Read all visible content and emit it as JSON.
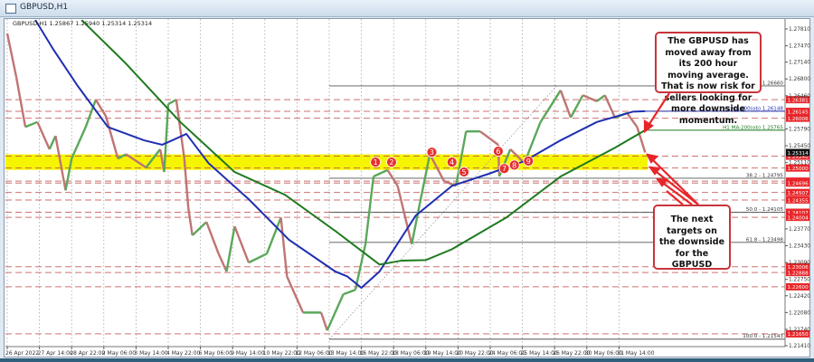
{
  "window": {
    "title": "GBPUSD,H1"
  },
  "info_line": "GBPUSD,H1  1.25867 1.25940 1.25314 1.25314",
  "callouts": {
    "top": "The GBPUSD has moved away from its 200 hour moving average. That is now risk for sellers looking for more downside momentum.",
    "bottom": "The next targets on the downside for the GBPUSD"
  },
  "colors": {
    "ma100": "#1f2fb0",
    "ma200": "#1e7a1e",
    "up": "#5aa85a",
    "down": "#c07474",
    "level": "#c0504d",
    "zone": "#f5f500",
    "label": "#e8262a"
  },
  "chart_data": {
    "type": "line",
    "title": "GBPUSD,H1",
    "x_unit": "hourly bar index",
    "ylim": [
      1.2141,
      1.2781
    ],
    "grid": true,
    "x_ticks": [
      {
        "bar": 0,
        "label": "26 Apr 2022"
      },
      {
        "bar": 16,
        "label": "27 Apr 14:00"
      },
      {
        "bar": 32,
        "label": "28 Apr 22:00"
      },
      {
        "bar": 48,
        "label": "2 May 06:00"
      },
      {
        "bar": 64,
        "label": "3 May 14:00"
      },
      {
        "bar": 80,
        "label": "4 May 22:00"
      },
      {
        "bar": 96,
        "label": "6 May 06:00"
      },
      {
        "bar": 112,
        "label": "9 May 14:00"
      },
      {
        "bar": 128,
        "label": "10 May 22:00"
      },
      {
        "bar": 144,
        "label": "12 May 06:00"
      },
      {
        "bar": 160,
        "label": "13 May 14:00"
      },
      {
        "bar": 176,
        "label": "16 May 22:00"
      },
      {
        "bar": 192,
        "label": "18 May 06:00"
      },
      {
        "bar": 208,
        "label": "19 May 14:00"
      },
      {
        "bar": 224,
        "label": "20 May 22:00"
      },
      {
        "bar": 240,
        "label": "24 May 06:00"
      },
      {
        "bar": 256,
        "label": "25 May 14:00"
      },
      {
        "bar": 272,
        "label": "26 May 22:00"
      },
      {
        "bar": 288,
        "label": "30 May 06:00"
      },
      {
        "bar": 304,
        "label": "31 May 14:00"
      }
    ],
    "y_ticks": [
      "1.27810",
      "1.27470",
      "1.27140",
      "1.26800",
      "1.26460",
      "1.25790",
      "1.25450",
      "1.25110",
      "1.23770",
      "1.23430",
      "1.23090",
      "1.22750",
      "1.22420",
      "1.22080",
      "1.21740",
      "1.21410"
    ],
    "price": [
      [
        0,
        1.2772
      ],
      [
        4.5,
        1.2684
      ],
      [
        9,
        1.2583
      ],
      [
        15,
        1.2593
      ],
      [
        21,
        1.2538
      ],
      [
        24,
        1.2565
      ],
      [
        29,
        1.2455
      ],
      [
        32,
        1.2519
      ],
      [
        39,
        1.2583
      ],
      [
        44,
        1.2638
      ],
      [
        49,
        1.2605
      ],
      [
        55,
        1.2519
      ],
      [
        59,
        1.2528
      ],
      [
        69,
        1.2501
      ],
      [
        76,
        1.2538
      ],
      [
        78,
        1.2492
      ],
      [
        80,
        1.2629
      ],
      [
        84,
        1.2638
      ],
      [
        88,
        1.2519
      ],
      [
        90,
        1.2419
      ],
      [
        92,
        1.2364
      ],
      [
        99,
        1.2391
      ],
      [
        105,
        1.2327
      ],
      [
        109,
        1.2291
      ],
      [
        113,
        1.2382
      ],
      [
        120,
        1.2309
      ],
      [
        129,
        1.2327
      ],
      [
        136,
        1.24
      ],
      [
        139,
        1.2281
      ],
      [
        147,
        1.2208
      ],
      [
        156,
        1.2208
      ],
      [
        159,
        1.2172
      ],
      [
        167,
        1.2245
      ],
      [
        173,
        1.2254
      ],
      [
        178,
        1.2346
      ],
      [
        182,
        1.2483
      ],
      [
        189,
        1.2496
      ],
      [
        194,
        1.2464
      ],
      [
        201,
        1.2346
      ],
      [
        205,
        1.2428
      ],
      [
        210,
        1.2528
      ],
      [
        217,
        1.2474
      ],
      [
        223,
        1.2464
      ],
      [
        228,
        1.2574
      ],
      [
        235,
        1.2574
      ],
      [
        244,
        1.2547
      ],
      [
        244.5,
        1.2483
      ],
      [
        250,
        1.2538
      ],
      [
        257,
        1.251
      ],
      [
        265,
        1.2593
      ],
      [
        275,
        1.2657
      ],
      [
        280,
        1.2602
      ],
      [
        286,
        1.2647
      ],
      [
        293,
        1.2635
      ],
      [
        297,
        1.2647
      ],
      [
        302,
        1.2602
      ],
      [
        308,
        1.2611
      ],
      [
        313,
        1.2583
      ],
      [
        317,
        1.25314
      ]
    ],
    "series": [
      {
        "name": "H1 MA:100",
        "label": "H1 MA:100(ob) 1.26148",
        "value": 1.26148,
        "points": [
          [
            14,
            1.2799
          ],
          [
            23,
            1.2739
          ],
          [
            35,
            1.2666
          ],
          [
            50,
            1.2583
          ],
          [
            68,
            1.2556
          ],
          [
            77,
            1.2547
          ],
          [
            82,
            1.2556
          ],
          [
            89,
            1.2569
          ],
          [
            100,
            1.251
          ],
          [
            120,
            1.2437
          ],
          [
            140,
            1.2355
          ],
          [
            163,
            1.2291
          ],
          [
            169,
            1.2281
          ],
          [
            176,
            1.2258
          ],
          [
            185,
            1.2291
          ],
          [
            203,
            1.2404
          ],
          [
            221,
            1.2464
          ],
          [
            239,
            1.2488
          ],
          [
            257,
            1.2514
          ],
          [
            275,
            1.2556
          ],
          [
            293,
            1.2593
          ],
          [
            311,
            1.2614
          ],
          [
            317,
            1.26148
          ]
        ]
      },
      {
        "name": "H1 MA:200",
        "label": "H1 MA:200(ob) 1.25765",
        "value": 1.25765,
        "points": [
          [
            37,
            1.2799
          ],
          [
            59,
            1.2711
          ],
          [
            86,
            1.2593
          ],
          [
            113,
            1.2492
          ],
          [
            138,
            1.2446
          ],
          [
            163,
            1.2373
          ],
          [
            185,
            1.2305
          ],
          [
            196,
            1.2313
          ],
          [
            208,
            1.2314
          ],
          [
            221,
            1.2336
          ],
          [
            248,
            1.24
          ],
          [
            275,
            1.2483
          ],
          [
            302,
            1.2541
          ],
          [
            317,
            1.25765
          ]
        ]
      }
    ],
    "fib": {
      "start_bar": 160,
      "end_bar": 273,
      "levels": [
        {
          "label": "0.0 - 1.26660",
          "value": 1.2666
        },
        {
          "label": "38.2 - 1.24795",
          "value": 1.24795
        },
        {
          "label": "50.0 - 1.24105",
          "value": 1.24105
        },
        {
          "label": "61.8 - 1.23498",
          "value": 1.23498
        },
        {
          "label": "100.0 - 1.21543",
          "value": 1.21543
        }
      ]
    },
    "support_zone": [
      1.25,
      1.2524
    ],
    "levels": [
      "1.26381",
      "1.26145",
      "1.26006",
      "1.25240",
      "1.25000",
      "1.24736",
      "1.24696",
      "1.24507",
      "1.24355",
      "1.24107",
      "1.24004",
      "1.23006",
      "1.22888",
      "1.22600",
      "1.21650"
    ],
    "current_price": "1.25314",
    "markers": [
      {
        "n": "1",
        "bar": 183,
        "price": 1.2512
      },
      {
        "n": "2",
        "bar": 191,
        "price": 1.2512
      },
      {
        "n": "3",
        "bar": 211,
        "price": 1.2532
      },
      {
        "n": "4",
        "bar": 221,
        "price": 1.2512
      },
      {
        "n": "5",
        "bar": 227,
        "price": 1.2492
      },
      {
        "n": "6",
        "bar": 244,
        "price": 1.2534
      },
      {
        "n": "7",
        "bar": 247,
        "price": 1.2499
      },
      {
        "n": "8",
        "bar": 252,
        "price": 1.2506
      },
      {
        "n": "9",
        "bar": 259,
        "price": 1.2514
      }
    ]
  }
}
